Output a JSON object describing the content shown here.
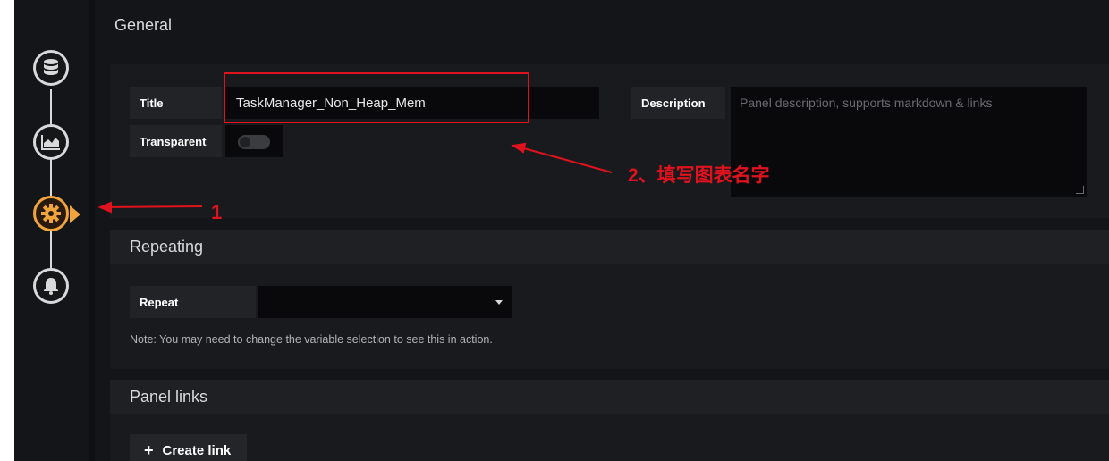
{
  "general": {
    "header": "General",
    "title_label": "Title",
    "title_value": "TaskManager_Non_Heap_Mem",
    "transparent_label": "Transparent",
    "transparent_on": false,
    "description_label": "Description",
    "description_placeholder": "Panel description, supports markdown & links"
  },
  "repeating": {
    "header": "Repeating",
    "repeat_label": "Repeat",
    "repeat_value": "",
    "note": "Note: You may need to change the variable selection to see this in action."
  },
  "panel_links": {
    "header": "Panel links",
    "create_link_label": "Create link"
  },
  "rail": {
    "steps": [
      "database-icon",
      "chart-area-icon",
      "settings-gear-icon",
      "bell-icon"
    ],
    "active_step": "settings-gear-icon"
  },
  "annotations": {
    "step1_label": "1",
    "step2_label": "2、填写图表名字",
    "color": "#e0121e"
  },
  "theme": {
    "accent": "#f0a43c"
  }
}
